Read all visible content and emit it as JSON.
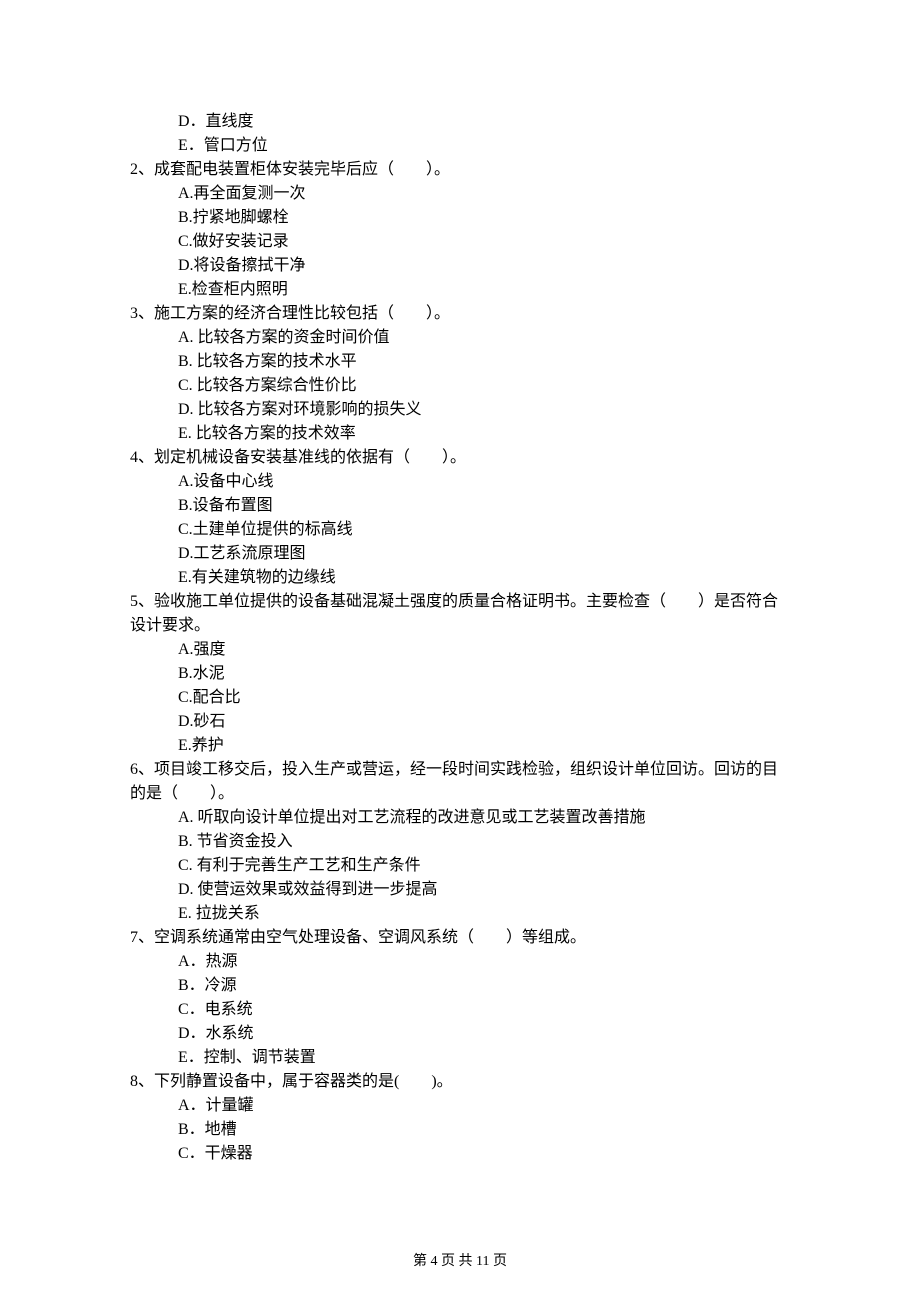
{
  "preOptions": [
    "D．直线度",
    "E．管口方位"
  ],
  "questions": [
    {
      "stem": "2、成套配电装置柜体安装完毕后应（　　）。",
      "options": [
        "A.再全面复测一次",
        "B.拧紧地脚螺栓",
        "C.做好安装记录",
        "D.将设备擦拭干净",
        "E.检查柜内照明"
      ]
    },
    {
      "stem": "3、施工方案的经济合理性比较包括（　　）。",
      "options": [
        "A. 比较各方案的资金时间价值",
        "B. 比较各方案的技术水平",
        "C. 比较各方案综合性价比",
        "D. 比较各方案对环境影响的损失义",
        "E. 比较各方案的技术效率"
      ]
    },
    {
      "stem": "4、划定机械设备安装基准线的依据有（　　）。",
      "options": [
        "A.设备中心线",
        "B.设备布置图",
        "C.土建单位提供的标高线",
        "D.工艺系流原理图",
        "E.有关建筑物的边缘线"
      ]
    },
    {
      "stem": "5、验收施工单位提供的设备基础混凝土强度的质量合格证明书。主要检查（　　）是否符合设计要求。",
      "options": [
        "A.强度",
        "B.水泥",
        "C.配合比",
        "D.砂石",
        "E.养护"
      ]
    },
    {
      "stem": "6、项目竣工移交后，投入生产或营运，经一段时间实践检验，组织设计单位回访。回访的目的是（　　）。",
      "options": [
        "A. 听取向设计单位提出对工艺流程的改进意见或工艺装置改善措施",
        "B. 节省资金投入",
        "C. 有利于完善生产工艺和生产条件",
        "D. 使营运效果或效益得到进一步提高",
        "E. 拉拢关系"
      ]
    },
    {
      "stem": "7、空调系统通常由空气处理设备、空调风系统（　　）等组成。",
      "options": [
        "A．热源",
        "B．冷源",
        "C．电系统",
        "D．水系统",
        "E．控制、调节装置"
      ]
    },
    {
      "stem": "8、下列静置设备中，属于容器类的是(　　)。",
      "options": [
        "A．计量罐",
        "B．地槽",
        "C．干燥器"
      ]
    }
  ],
  "footer": "第 4 页 共 11 页"
}
